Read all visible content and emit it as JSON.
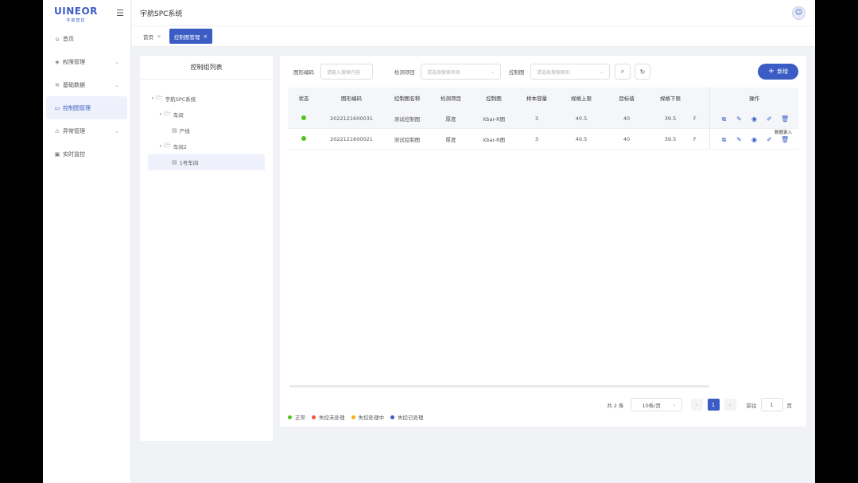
{
  "sidebar": {
    "logo_text": "UINEOR",
    "logo_sub": "宇航智控",
    "items": [
      {
        "label": "首页",
        "icon": "home-icon",
        "has_children": false
      },
      {
        "label": "权限管理",
        "icon": "shield-icon",
        "has_children": true
      },
      {
        "label": "基础数据",
        "icon": "database-icon",
        "has_children": true
      },
      {
        "label": "控制图管理",
        "icon": "monitor-icon",
        "has_children": false,
        "active": true
      },
      {
        "label": "异常管理",
        "icon": "warning-icon",
        "has_children": true
      },
      {
        "label": "实时监控",
        "icon": "monitor-eye-icon",
        "has_children": false
      }
    ]
  },
  "header": {
    "title": "宇航SPC系统"
  },
  "tabs": [
    {
      "label": "首页",
      "active": false
    },
    {
      "label": "控制图管理",
      "active": true
    }
  ],
  "tree": {
    "title": "控制组列表",
    "nodes": [
      {
        "label": "宇航SPC系统",
        "level": 0,
        "expanded": true
      },
      {
        "label": "车间",
        "level": 1,
        "expanded": true
      },
      {
        "label": "产线",
        "level": 2,
        "expanded": false
      },
      {
        "label": "车间2",
        "level": 1,
        "expanded": true
      },
      {
        "label": "1号车间",
        "level": 2,
        "expanded": false,
        "selected": true
      }
    ]
  },
  "search": {
    "code_label": "图形编码",
    "code_placeholder": "请输入搜索内容",
    "item_label": "检测项目",
    "item_placeholder": "请选择搜索项目",
    "chart_label": "控制图",
    "chart_placeholder": "请选择搜索图形",
    "add_label": "新增"
  },
  "table": {
    "headers": [
      "状态",
      "图形编码",
      "控制图名称",
      "检测项目",
      "控制图",
      "样本容量",
      "规格上限",
      "目标值",
      "规格下限",
      "操作"
    ],
    "rows": [
      {
        "status_color": "#52c41a",
        "code": "2022121600031",
        "name": "测试控制图",
        "item": "厚度",
        "chart": "Xbar-R图",
        "sample": "3",
        "usl": "40.5",
        "target": "40",
        "lsl": "39.5",
        "cut": "F"
      },
      {
        "status_color": "#52c41a",
        "code": "2022121600021",
        "name": "测试控制图",
        "item": "厚度",
        "chart": "Xbar-R图",
        "sample": "3",
        "usl": "40.5",
        "target": "40",
        "lsl": "39.5",
        "cut": "F"
      }
    ],
    "tooltip": "数据录入"
  },
  "pagination": {
    "total": "共 2 条",
    "page_size": "10条/页",
    "current_page": "1",
    "goto_label": "前往",
    "goto_value": "1",
    "page_unit": "页"
  },
  "legend": [
    {
      "label": "正常",
      "color": "#52c41a"
    },
    {
      "label": "失控未处理",
      "color": "#f5533d"
    },
    {
      "label": "失控处理中",
      "color": "#faad14"
    },
    {
      "label": "失控已处理",
      "color": "#3b5cc4"
    }
  ]
}
